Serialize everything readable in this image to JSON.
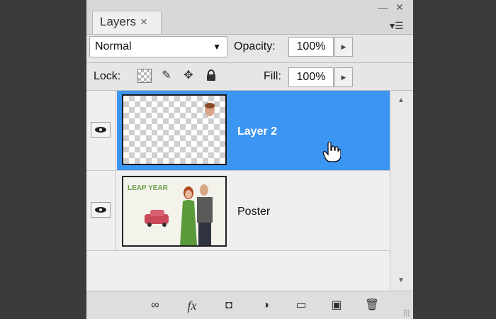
{
  "panel": {
    "tab_label": "Layers",
    "tab_close": "×",
    "panel_menu": "▾☰",
    "minimize": "—",
    "close": "✕"
  },
  "controls": {
    "blend_mode": "Normal",
    "opacity_label": "Opacity:",
    "opacity_value": "100%",
    "lock_label": "Lock:",
    "fill_label": "Fill:",
    "fill_value": "100%",
    "spin_arrow": "▶"
  },
  "layers": [
    {
      "name": "Layer 2",
      "selected": true,
      "visible": true
    },
    {
      "name": "Poster",
      "selected": false,
      "visible": true
    }
  ],
  "poster_thumb": {
    "logo_text": "LEAP YEAR"
  },
  "icons": {
    "blend_dropdown": "▼",
    "lock_paint": "✎",
    "lock_move": "✥",
    "scroll_up": "▲",
    "scroll_down": "▼",
    "link": "∞",
    "fx": "fx",
    "mask": "◘",
    "adjustment": "◑",
    "group": "▭",
    "new_layer": "▣",
    "trash": "🗑"
  }
}
